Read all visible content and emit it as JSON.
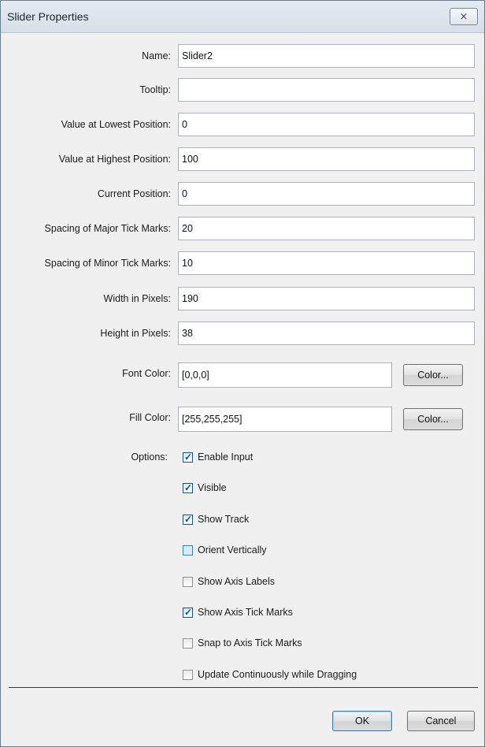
{
  "window": {
    "title": "Slider Properties",
    "close_glyph": "⨯"
  },
  "fields": {
    "name": {
      "label": "Name:",
      "value": "Slider2"
    },
    "tooltip": {
      "label": "Tooltip:",
      "value": ""
    },
    "value_lowest": {
      "label": "Value at Lowest Position:",
      "value": "0"
    },
    "value_highest": {
      "label": "Value at Highest Position:",
      "value": "100"
    },
    "current_position": {
      "label": "Current Position:",
      "value": "0"
    },
    "major_tick": {
      "label": "Spacing of Major Tick Marks:",
      "value": "20"
    },
    "minor_tick": {
      "label": "Spacing of Minor Tick Marks:",
      "value": "10"
    },
    "width": {
      "label": "Width in Pixels:",
      "value": "190"
    },
    "height": {
      "label": "Height in Pixels:",
      "value": "38"
    },
    "font_color": {
      "label": "Font Color:",
      "value": "[0,0,0]",
      "button": "Color..."
    },
    "fill_color": {
      "label": "Fill Color:",
      "value": "[255,255,255]",
      "button": "Color..."
    }
  },
  "options": {
    "label": "Options:",
    "items": [
      {
        "label": "Enable Input",
        "checked": true
      },
      {
        "label": "Visible",
        "checked": true
      },
      {
        "label": "Show Track",
        "checked": true
      },
      {
        "label": "Orient Vertically",
        "checked": false
      },
      {
        "label": "Show Axis Labels",
        "checked": false
      },
      {
        "label": "Show Axis Tick Marks",
        "checked": true
      },
      {
        "label": "Snap to Axis Tick Marks",
        "checked": false
      },
      {
        "label": "Update Continuously while Dragging",
        "checked": false
      }
    ]
  },
  "footer": {
    "ok_label": "OK",
    "cancel_label": "Cancel"
  }
}
